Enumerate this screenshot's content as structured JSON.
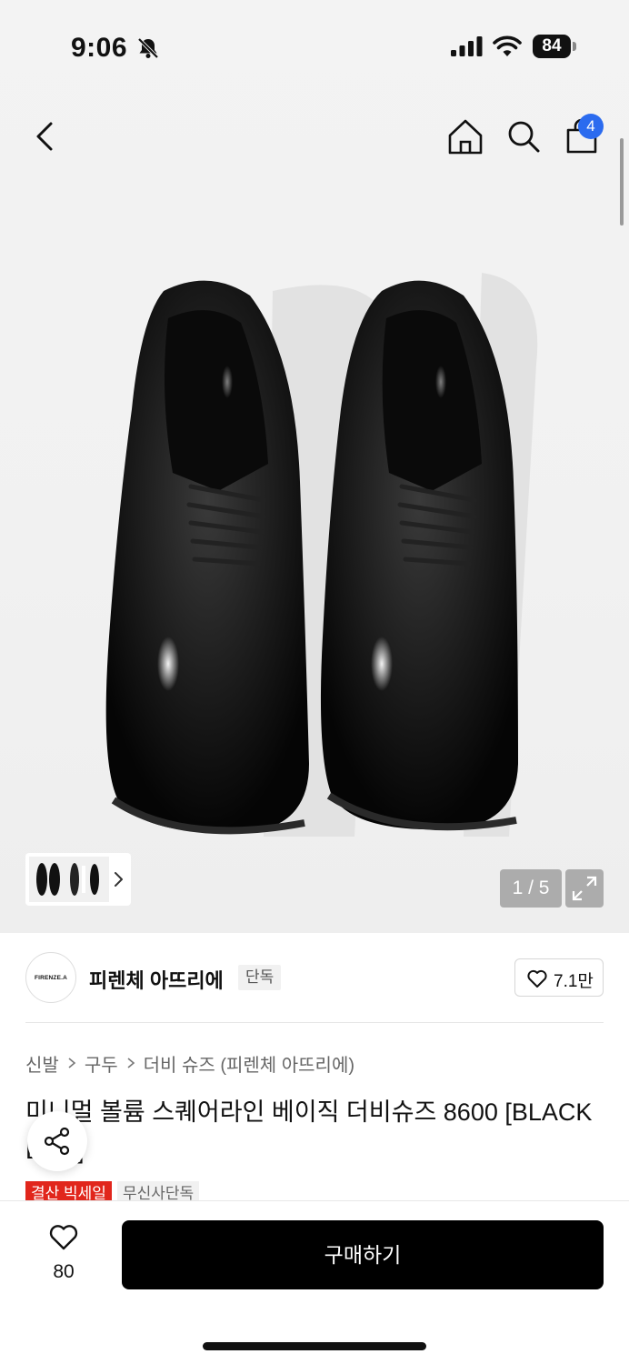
{
  "status_bar": {
    "time": "9:06",
    "battery": "84"
  },
  "nav": {
    "cart_badge": "4"
  },
  "gallery": {
    "pager": "1 / 5"
  },
  "brand": {
    "logo_text": "FIRENZE.A",
    "name": "피렌체 아뜨리에",
    "tag": "단독",
    "likes": "7.1만"
  },
  "breadcrumb": [
    "신발",
    "구두",
    "더비 슈즈 (피렌체 아뜨리에)"
  ],
  "product": {
    "title": "미니멀 볼륨 스퀘어라인 베이직 더비슈즈 8600 [BLACK BOX]",
    "tags": [
      "결산 빅세일",
      "무신사단독"
    ]
  },
  "bottom_bar": {
    "wish_count": "80",
    "buy_label": "구매하기"
  },
  "colors": {
    "accent_blue": "#2b6bef",
    "sale_red": "#e1261c",
    "buy_black": "#000000"
  },
  "icons": [
    "back-icon",
    "home-icon",
    "search-icon",
    "cart-icon",
    "bell-slash-icon",
    "signal-icon",
    "wifi-icon",
    "expand-icon",
    "heart-icon",
    "share-icon",
    "chevron-right-icon"
  ]
}
